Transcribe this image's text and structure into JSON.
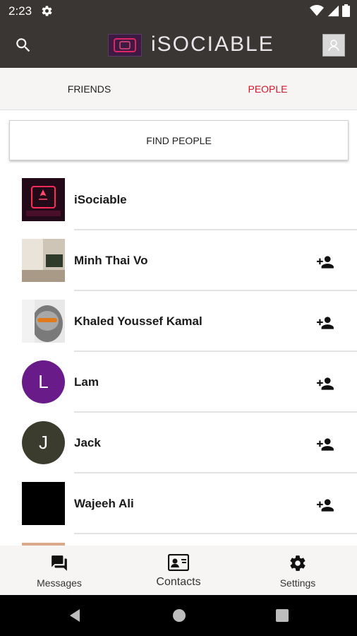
{
  "status_bar": {
    "time": "2:23"
  },
  "app_bar": {
    "title": "iSOCIABLE"
  },
  "tabs": [
    {
      "label": "FRIENDS",
      "active": false
    },
    {
      "label": "PEOPLE",
      "active": true
    }
  ],
  "find_people_label": "FIND PEOPLE",
  "people": [
    {
      "name": "iSociable",
      "avatar": "logo-image",
      "has_add": false
    },
    {
      "name": "Minh Thai Vo",
      "avatar": "photo-room",
      "has_add": true
    },
    {
      "name": "Khaled Youssef Kamal",
      "avatar": "photo-face",
      "has_add": true
    },
    {
      "name": "Lam",
      "avatar_letter": "L",
      "avatar_color": "#6a1b8a",
      "has_add": true
    },
    {
      "name": "Jack",
      "avatar_letter": "J",
      "avatar_color": "#3b3b2e",
      "has_add": true
    },
    {
      "name": "Wajeeh Ali",
      "avatar": "photo-black",
      "has_add": true
    }
  ],
  "bottom_nav": [
    {
      "label": "Messages",
      "icon": "chat-icon"
    },
    {
      "label": "Contacts",
      "icon": "contact-card-icon"
    },
    {
      "label": "Settings",
      "icon": "gear-icon"
    }
  ],
  "colors": {
    "bar_bg": "#3a3633",
    "accent": "#d4142a",
    "surface": "#f6f5f3"
  }
}
